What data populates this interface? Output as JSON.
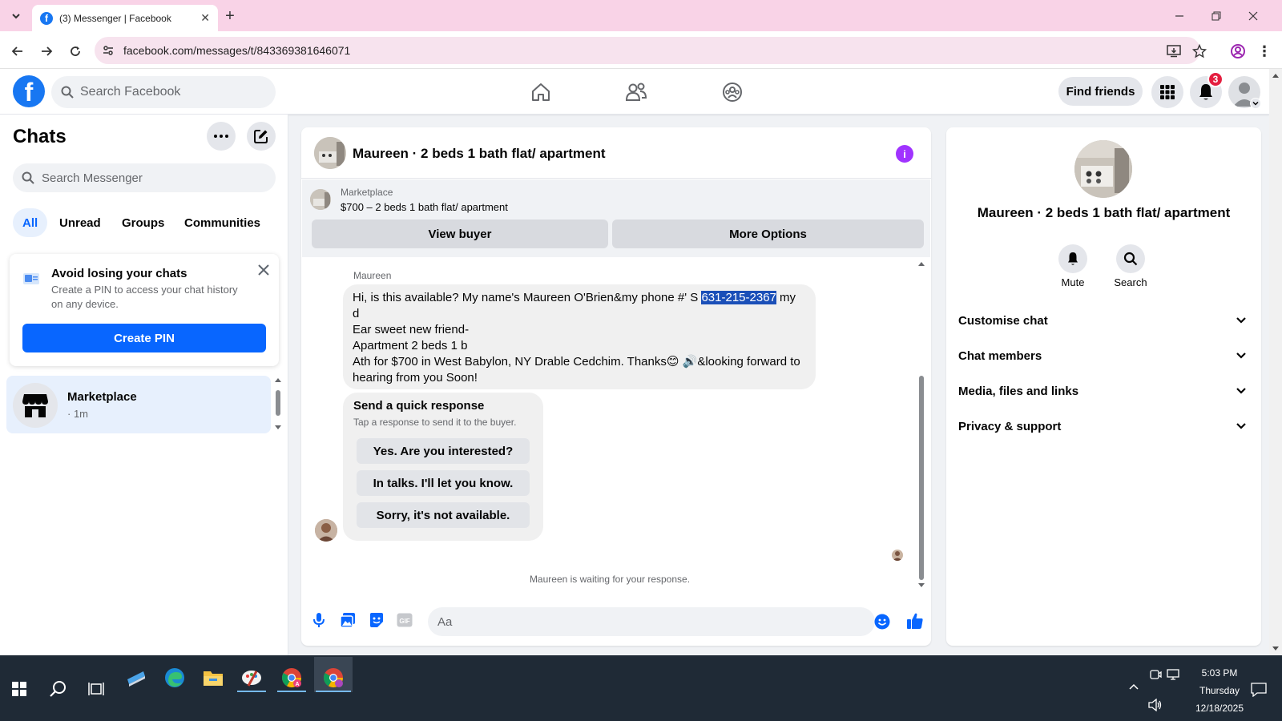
{
  "browser": {
    "tab_title": "(3) Messenger | Facebook",
    "url": "facebook.com/messages/t/843369381646071",
    "accent": "#f9d3e7"
  },
  "header": {
    "search_placeholder": "Search Facebook",
    "find_friends": "Find friends",
    "notification_count": "3",
    "brand_color": "#1877f2"
  },
  "sidebar": {
    "title": "Chats",
    "search_placeholder": "Search Messenger",
    "filters": [
      "All",
      "Unread",
      "Groups",
      "Communities"
    ],
    "pin_card": {
      "title": "Avoid losing your chats",
      "text_line1": "Create a PIN to access your chat history",
      "text_line2": "on any device.",
      "button": "Create PIN"
    },
    "chat_item": {
      "name": "Marketplace",
      "meta": "· 1m"
    }
  },
  "conversation": {
    "title": "Maureen · 2 beds 1 bath flat/ apartment",
    "marketplace_label": "Marketplace",
    "listing": "$700 – 2 beds 1 bath flat/ apartment",
    "view_buyer": "View buyer",
    "more_options": "More Options",
    "sender": "Maureen",
    "message": {
      "line1_before": "Hi, is this available?  My name's Maureen O'Brien&my phone #' S ",
      "line1_phone": "631-215-2367",
      "line1_after": " my",
      "line2": "d",
      "line3": "Ear sweet new friend-",
      "line4": "Apartment 2 beds 1 b",
      "line5": "Ath for $700 in West Babylon, NY Drable Cedchim.  Thanks😊 🔊&looking forward to",
      "line6": "hearing from you Soon!"
    },
    "quick_response": {
      "title": "Send a quick response",
      "subtitle": "Tap a response to send it to the buyer.",
      "options": [
        "Yes. Are you interested?",
        "In talks. I'll let you know.",
        "Sorry, it's not available."
      ]
    },
    "waiting": "Maureen is waiting for your response.",
    "composer_placeholder": "Aa"
  },
  "details": {
    "title": "Maureen · 2 beds 1 bath flat/ apartment",
    "mute": "Mute",
    "search": "Search",
    "sections": [
      "Customise chat",
      "Chat members",
      "Media, files and links",
      "Privacy & support"
    ]
  },
  "taskbar": {
    "time": "5:03 PM",
    "day": "Thursday",
    "date": "12/18/2025"
  }
}
